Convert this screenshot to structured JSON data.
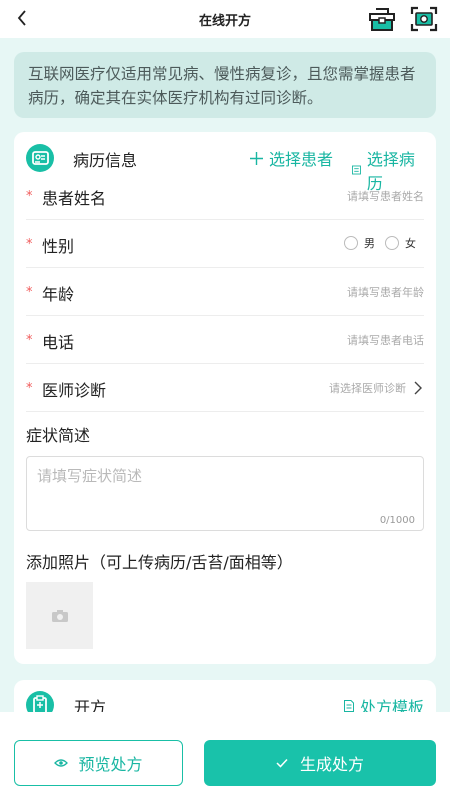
{
  "header": {
    "title": "在线开方"
  },
  "notice": {
    "text": "互联网医疗仅适用常见病、慢性病复诊，且您需掌握患者病历，确定其在实体医疗机构有过同诊断。"
  },
  "medical_record": {
    "title": "病历信息",
    "select_patient": "选择患者",
    "select_record": "选择病历",
    "fields": [
      {
        "label": "患者姓名",
        "placeholder": "请填写患者姓名"
      },
      {
        "label": "性别",
        "options": [
          "男",
          "女"
        ]
      },
      {
        "label": "年龄",
        "placeholder": "请填写患者年龄"
      },
      {
        "label": "电话",
        "placeholder": "请填写患者电话"
      },
      {
        "label": "医师诊断",
        "placeholder": "请选择医师诊断"
      }
    ],
    "required_mark": "*",
    "symptoms_label": "症状简述",
    "symptoms_placeholder": "请填写症状简述",
    "symptoms_counter": "0/1000",
    "photo_label": "添加照片（可上传病历/舌苔/面相等）"
  },
  "prescription": {
    "title": "开方",
    "template": "处方模板"
  },
  "actions": {
    "preview": "预览处方",
    "generate": "生成处方"
  },
  "colors": {
    "accent": "#19bfa6",
    "background": "#e7f7f5",
    "required": "#f05a5a"
  }
}
